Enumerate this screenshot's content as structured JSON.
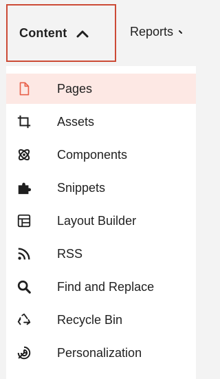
{
  "nav": {
    "content_label": "Content",
    "reports_label": "Reports"
  },
  "menu": {
    "accent_color": "#e8604a",
    "items": [
      {
        "label": "Pages",
        "icon": "page-icon",
        "active": true
      },
      {
        "label": "Assets",
        "icon": "crop-icon",
        "active": false
      },
      {
        "label": "Components",
        "icon": "atom-icon",
        "active": false
      },
      {
        "label": "Snippets",
        "icon": "puzzle-icon",
        "active": false
      },
      {
        "label": "Layout Builder",
        "icon": "layout-icon",
        "active": false
      },
      {
        "label": "RSS",
        "icon": "rss-icon",
        "active": false
      },
      {
        "label": "Find and Replace",
        "icon": "search-icon",
        "active": false
      },
      {
        "label": "Recycle Bin",
        "icon": "recycle-icon",
        "active": false
      },
      {
        "label": "Personalization",
        "icon": "target-icon",
        "active": false
      }
    ]
  }
}
